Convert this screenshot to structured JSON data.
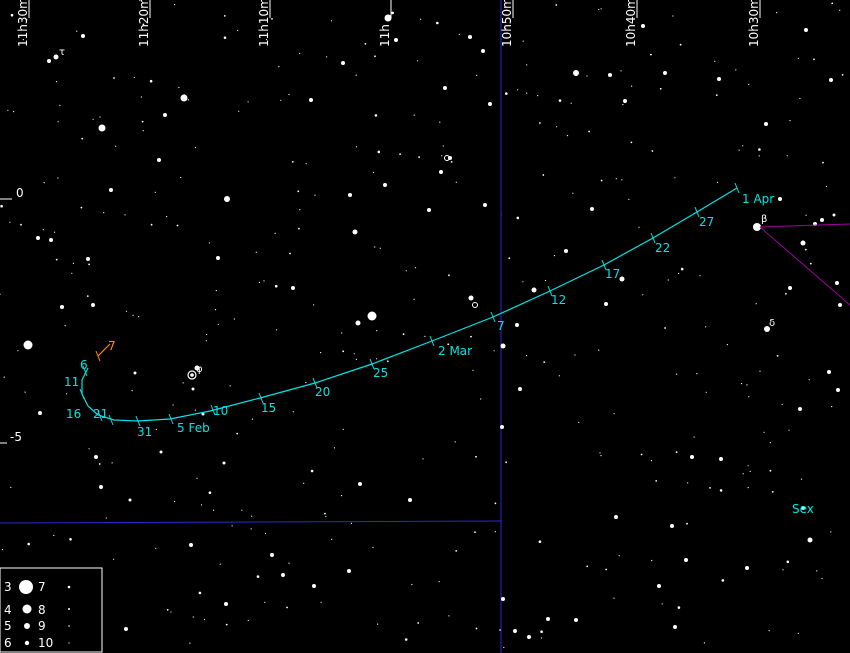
{
  "colors": {
    "background": "#000000",
    "star": "#ffffff",
    "path": "#00e5e5",
    "path_start": "#ff8c00",
    "grid": "#2a2ad0",
    "constellation_line": "#a000a0",
    "constellation_label": "#00e5e5",
    "legend_border": "#ffffff"
  },
  "ra_axis_labels": [
    {
      "text": "11h30m",
      "ra": 690
    },
    {
      "text": "11h20m",
      "ra": 680
    },
    {
      "text": "11h10m",
      "ra": 670
    },
    {
      "text": "11h",
      "ra": 660
    },
    {
      "text": "10h50m",
      "ra": 650
    },
    {
      "text": "10h40m",
      "ra": 640
    },
    {
      "text": "10h30m",
      "ra": 630
    }
  ],
  "dec_axis_labels": [
    {
      "text": "0",
      "dec": 0
    },
    {
      "text": "-5",
      "dec": -5
    }
  ],
  "path_dates": [
    {
      "text": "7",
      "start": true
    },
    {
      "text": "6"
    },
    {
      "text": "11"
    },
    {
      "text": "16"
    },
    {
      "text": "21"
    },
    {
      "text": "31"
    },
    {
      "text": "5 Feb"
    },
    {
      "text": "10"
    },
    {
      "text": "15"
    },
    {
      "text": "20"
    },
    {
      "text": "25"
    },
    {
      "text": "2 Mar"
    },
    {
      "text": "7"
    },
    {
      "text": "12"
    },
    {
      "text": "17"
    },
    {
      "text": "22"
    },
    {
      "text": "27"
    },
    {
      "text": "1 Apr"
    }
  ],
  "star_labels": [
    {
      "text": "β"
    },
    {
      "text": "δ"
    },
    {
      "text": "τ"
    },
    {
      "text": "φ"
    }
  ],
  "constellation": "Sex",
  "legend": [
    {
      "mag": "3"
    },
    {
      "mag": "4"
    },
    {
      "mag": "5"
    },
    {
      "mag": "6"
    },
    {
      "mag": "7"
    },
    {
      "mag": "8"
    },
    {
      "mag": "9"
    },
    {
      "mag": "10"
    }
  ]
}
